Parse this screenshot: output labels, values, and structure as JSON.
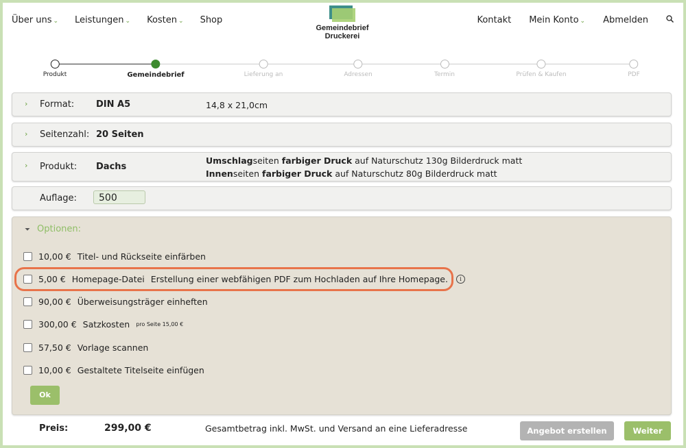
{
  "nav": {
    "left": [
      {
        "label": "Über uns",
        "has_dropdown": true
      },
      {
        "label": "Leistungen",
        "has_dropdown": true
      },
      {
        "label": "Kosten",
        "has_dropdown": true
      },
      {
        "label": "Shop",
        "has_dropdown": false
      }
    ],
    "right": [
      {
        "label": "Kontakt",
        "has_dropdown": false
      },
      {
        "label": "Mein Konto",
        "has_dropdown": true
      },
      {
        "label": "Abmelden",
        "has_dropdown": false
      }
    ],
    "chevron": "⌄",
    "search_icon": "search-icon"
  },
  "logo": {
    "line1": "Gemeindebrief",
    "line2": "Druckerei"
  },
  "steps": [
    {
      "label": "Produkt",
      "state": "done"
    },
    {
      "label": "Gemeindebrief",
      "state": "active"
    },
    {
      "label": "Lieferung an",
      "state": "todo"
    },
    {
      "label": "Adressen",
      "state": "todo"
    },
    {
      "label": "Termin",
      "state": "todo"
    },
    {
      "label": "Prüfen & Kaufen",
      "state": "todo"
    },
    {
      "label": "PDF",
      "state": "todo"
    }
  ],
  "format": {
    "label": "Format:",
    "value": "DIN A5",
    "detail": "14,8 x 21,0cm"
  },
  "pages": {
    "label": "Seitenzahl:",
    "value": "20 Seiten"
  },
  "product": {
    "label": "Produkt:",
    "value": "Dachs",
    "line1": {
      "b1": "Umschlag",
      "t1": "seiten ",
      "b2": "farbiger Druck",
      "t2": " auf Naturschutz 130g Bilderdruck matt"
    },
    "line2": {
      "b1": "Innen",
      "t1": "seiten ",
      "b2": "farbiger Druck",
      "t2": " auf Naturschutz 80g Bilderdruck matt"
    }
  },
  "quantity": {
    "label": "Auflage:",
    "value": "500"
  },
  "options": {
    "title": "Optionen:",
    "items": [
      {
        "price": "10,00 €",
        "name": "Titel- und Rückseite einfärben",
        "note": "",
        "checked": false
      },
      {
        "price": "5,00 €",
        "name": "Homepage-Datei",
        "note": "Erstellung einer webfähigen PDF zum Hochladen auf Ihre Homepage.",
        "checked": false
      },
      {
        "price": "90,00 €",
        "name": "Überweisungsträger einheften",
        "note": "",
        "checked": false
      },
      {
        "price": "300,00 €",
        "name": "Satzkosten",
        "note": "pro Seite 15,00 €",
        "checked": false
      },
      {
        "price": "57,50 €",
        "name": "Vorlage scannen",
        "note": "",
        "checked": false
      },
      {
        "price": "10,00 €",
        "name": "Gestaltete Titelseite einfügen",
        "note": "",
        "checked": false
      }
    ],
    "ok_label": "Ok",
    "info_glyph": "i"
  },
  "footer": {
    "price_label": "Preis:",
    "price_value": "299,00 €",
    "note": "Gesamtbetrag inkl. MwSt. und Versand an eine Lieferadresse",
    "offer_button": "Angebot erstellen",
    "next_button": "Weiter"
  },
  "colors": {
    "accent_green": "#9bbf6a",
    "highlight": "#e8734a",
    "step_active": "#3c8a2e"
  }
}
